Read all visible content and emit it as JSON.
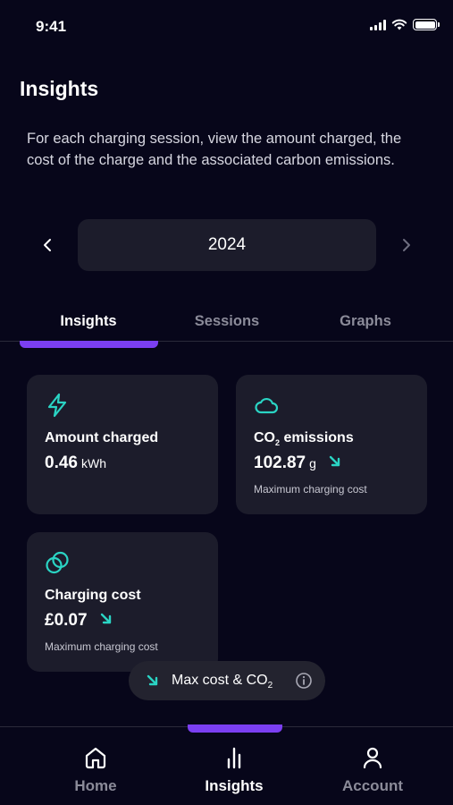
{
  "status_bar": {
    "time": "9:41"
  },
  "header": {
    "title": "Insights",
    "description": "For each charging session, view the amount charged, the cost of the charge and the associated carbon emissions."
  },
  "year_selector": {
    "year": "2024"
  },
  "tabs": [
    {
      "label": "Insights",
      "active": true
    },
    {
      "label": "Sessions",
      "active": false
    },
    {
      "label": "Graphs",
      "active": false
    }
  ],
  "cards": {
    "amount_charged": {
      "title": "Amount charged",
      "value": "0.46",
      "unit": "kWh",
      "icon": "lightning-icon"
    },
    "co2_emissions": {
      "title_prefix": "CO",
      "title_sub": "2",
      "title_suffix": " emissions",
      "value": "102.87",
      "unit": "g",
      "note": "Maximum charging cost",
      "icon": "cloud-icon"
    },
    "charging_cost": {
      "title": "Charging cost",
      "value": "£0.07",
      "note": "Maximum charging cost",
      "icon": "coins-icon"
    }
  },
  "chip": {
    "label_prefix": "Max cost & CO",
    "label_sub": "2",
    "icon": "info-icon"
  },
  "bottom_nav": [
    {
      "label": "Home",
      "icon": "home-icon",
      "active": false
    },
    {
      "label": "Insights",
      "icon": "bar-chart-icon",
      "active": true
    },
    {
      "label": "Account",
      "icon": "user-icon",
      "active": false
    }
  ],
  "colors": {
    "background": "#07061a",
    "card": "#1c1c2b",
    "accent": "#7b3ff2",
    "teal": "#2ad4c4"
  }
}
